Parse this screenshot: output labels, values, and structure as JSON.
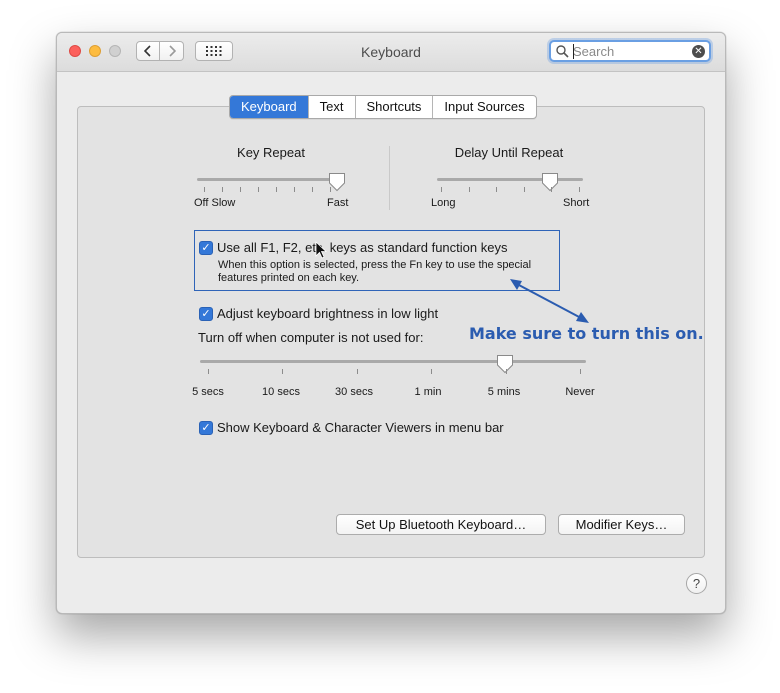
{
  "window": {
    "title": "Keyboard"
  },
  "toolbar": {
    "back_icon": "chevron-left-icon",
    "forward_icon": "chevron-right-icon",
    "show_all_icon": "grid-icon"
  },
  "search": {
    "placeholder": "Search",
    "value": ""
  },
  "tabs": [
    {
      "label": "Keyboard",
      "selected": true
    },
    {
      "label": "Text",
      "selected": false
    },
    {
      "label": "Shortcuts",
      "selected": false
    },
    {
      "label": "Input Sources",
      "selected": false
    }
  ],
  "key_repeat": {
    "label": "Key Repeat",
    "min_label": "Off Slow",
    "max_label": "Fast",
    "value_fraction": 1.0,
    "ticks": 8
  },
  "delay_until_repeat": {
    "label": "Delay Until Repeat",
    "min_label": "Long",
    "max_label": "Short",
    "value_fraction": 0.8,
    "ticks": 6
  },
  "function_keys": {
    "checked": true,
    "label": "Use all F1, F2, etc. keys as standard function keys",
    "description_line1": "When this option is selected, press the Fn key to use the special",
    "description_line2": "features printed on each key."
  },
  "brightness": {
    "checked": true,
    "label": "Adjust keyboard brightness in low light"
  },
  "turn_off": {
    "label": "Turn off when computer is not used for:",
    "options": [
      "5 secs",
      "10 secs",
      "30 secs",
      "1 min",
      "5 mins",
      "Never"
    ],
    "selected": "5 mins"
  },
  "viewers": {
    "checked": true,
    "label": "Show Keyboard & Character Viewers in menu bar"
  },
  "buttons": {
    "bluetooth": "Set Up Bluetooth Keyboard…",
    "modifier": "Modifier Keys…"
  },
  "help": {
    "label": "?"
  },
  "annotation": {
    "text": "Make sure to turn this on.",
    "color": "#2b5cb0"
  },
  "colors": {
    "accent": "#3478d8"
  }
}
